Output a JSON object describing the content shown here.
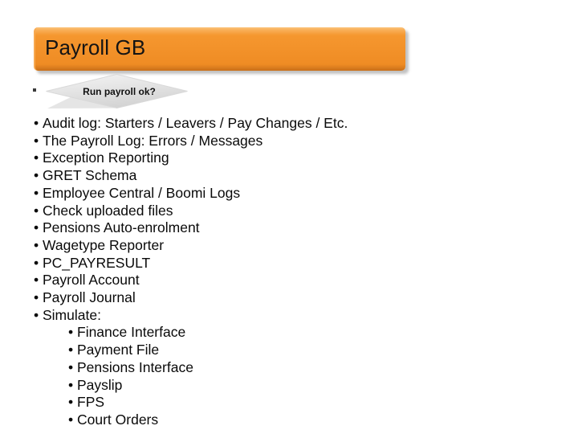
{
  "slide": {
    "background_color": "#ffffff",
    "title": {
      "text": "Payroll GB",
      "bar_color_top": "#f9b05a",
      "bar_color_mid": "#f3912a",
      "bar_color_bottom": "#c96f18",
      "text_color": "#141414"
    },
    "decision_shape": {
      "icon": "decision-diamond-icon",
      "label": "Run payroll ok?",
      "fill_color": "#e0e0e0",
      "light_edge_color": "#f2f2f2",
      "dark_edge_color": "#c8c8c8",
      "text_color": "#111111"
    },
    "bullet_char": "•",
    "bullets": [
      {
        "level": 1,
        "text": "Audit log: Starters / Leavers / Pay Changes / Etc."
      },
      {
        "level": 1,
        "text": "The Payroll Log: Errors / Messages"
      },
      {
        "level": 1,
        "text": "Exception Reporting"
      },
      {
        "level": 1,
        "text": "GRET Schema"
      },
      {
        "level": 1,
        "text": "Employee Central / Boomi Logs"
      },
      {
        "level": 1,
        "text": "Check uploaded files"
      },
      {
        "level": 1,
        "text": "Pensions Auto-enrolment"
      },
      {
        "level": 1,
        "text": "Wagetype Reporter"
      },
      {
        "level": 1,
        "text": "PC_PAYRESULT"
      },
      {
        "level": 1,
        "text": "Payroll Account"
      },
      {
        "level": 1,
        "text": "Payroll Journal"
      },
      {
        "level": 1,
        "text": "Simulate:"
      },
      {
        "level": 2,
        "text": "Finance Interface"
      },
      {
        "level": 2,
        "text": "Payment File"
      },
      {
        "level": 2,
        "text": "Pensions Interface"
      },
      {
        "level": 2,
        "text": "Payslip"
      },
      {
        "level": 2,
        "text": "FPS"
      },
      {
        "level": 2,
        "text": "Court Orders"
      }
    ]
  }
}
